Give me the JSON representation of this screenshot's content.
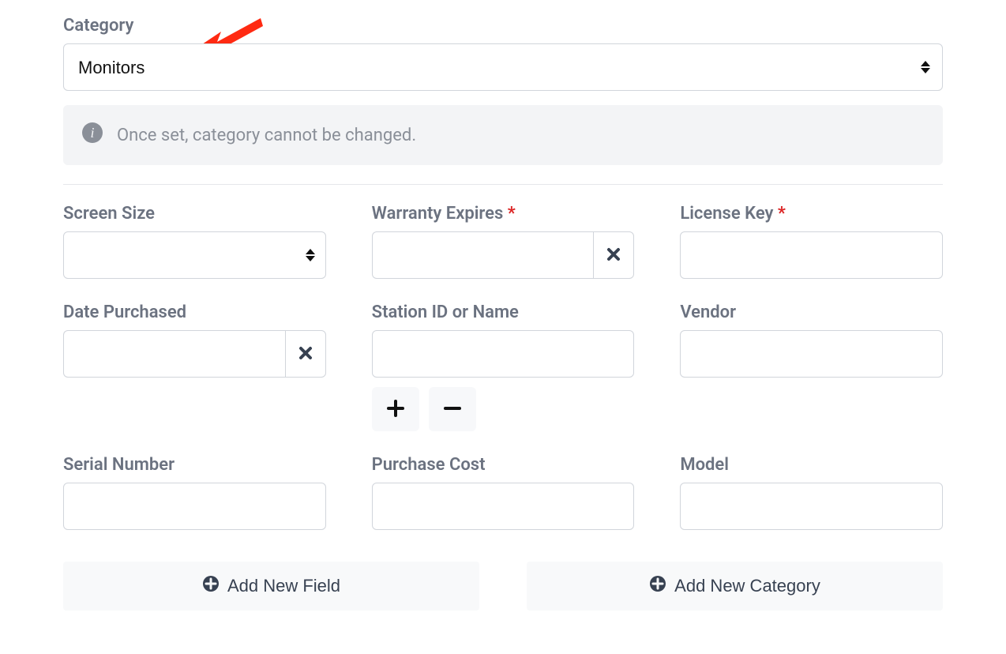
{
  "category": {
    "label": "Category",
    "value": "Monitors",
    "info_message": "Once set, category cannot be changed."
  },
  "fields": {
    "screen_size": {
      "label": "Screen Size",
      "value": ""
    },
    "warranty_expires": {
      "label": "Warranty Expires",
      "value": "",
      "required": true
    },
    "license_key": {
      "label": "License Key",
      "value": "",
      "required": true
    },
    "date_purchased": {
      "label": "Date Purchased",
      "value": ""
    },
    "station_id": {
      "label": "Station ID or Name",
      "value": ""
    },
    "vendor": {
      "label": "Vendor",
      "value": ""
    },
    "serial_number": {
      "label": "Serial Number",
      "value": ""
    },
    "purchase_cost": {
      "label": "Purchase Cost",
      "value": ""
    },
    "model": {
      "label": "Model",
      "value": ""
    }
  },
  "actions": {
    "add_field": "Add New Field",
    "add_category": "Add New Category"
  }
}
